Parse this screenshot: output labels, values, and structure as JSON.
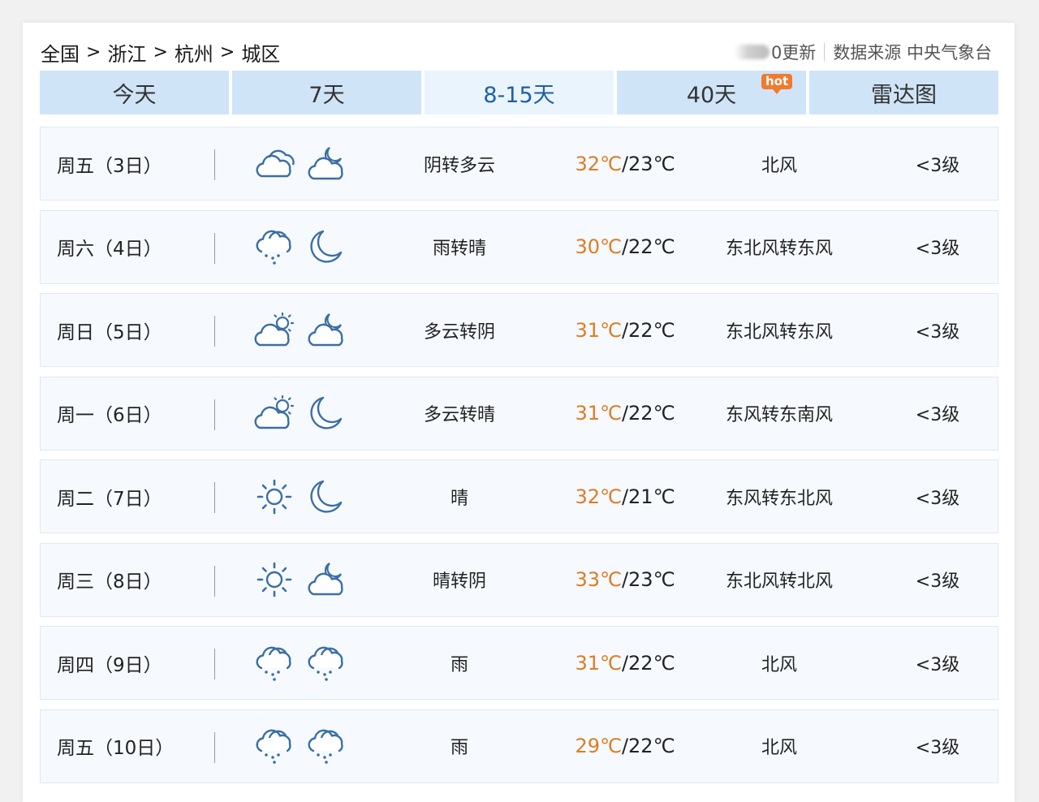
{
  "breadcrumb": {
    "items": [
      "全国",
      "浙江",
      "杭州",
      "城区"
    ],
    "separator": ">"
  },
  "meta": {
    "update_text": "0更新",
    "source_text": "数据来源 中央气象台"
  },
  "tabs": [
    {
      "label": "今天",
      "active": false
    },
    {
      "label": "7天",
      "active": false
    },
    {
      "label": "8-15天",
      "active": true
    },
    {
      "label": "40天",
      "active": false,
      "badge": "hot"
    },
    {
      "label": "雷达图",
      "active": false
    }
  ],
  "colors": {
    "tab_bg": "#cfe4f7",
    "tab_active_bg": "#eaf4fd",
    "tab_active_text": "#1f5fa6",
    "high_temp": "#e07b22",
    "icon_stroke": "#3a6fa5",
    "hot_badge": "#f07a2e"
  },
  "forecast": [
    {
      "day": "周五（3日）",
      "icon_day": "cloudy-icon",
      "icon_night": "partly-cloudy-night-icon",
      "weather": "阴转多云",
      "high": "32℃",
      "low": "/23℃",
      "wind": "北风",
      "level": "<3级"
    },
    {
      "day": "周六（4日）",
      "icon_day": "rain-icon",
      "icon_night": "moon-icon",
      "weather": "雨转晴",
      "high": "30℃",
      "low": "/22℃",
      "wind": "东北风转东风",
      "level": "<3级"
    },
    {
      "day": "周日（5日）",
      "icon_day": "partly-cloudy-day-icon",
      "icon_night": "partly-cloudy-night-icon",
      "weather": "多云转阴",
      "high": "31℃",
      "low": "/22℃",
      "wind": "东北风转东风",
      "level": "<3级"
    },
    {
      "day": "周一（6日）",
      "icon_day": "partly-cloudy-day-icon",
      "icon_night": "moon-icon",
      "weather": "多云转晴",
      "high": "31℃",
      "low": "/22℃",
      "wind": "东风转东南风",
      "level": "<3级"
    },
    {
      "day": "周二（7日）",
      "icon_day": "sun-icon",
      "icon_night": "moon-icon",
      "weather": "晴",
      "high": "32℃",
      "low": "/21℃",
      "wind": "东风转东北风",
      "level": "<3级"
    },
    {
      "day": "周三（8日）",
      "icon_day": "sun-icon",
      "icon_night": "partly-cloudy-night-icon",
      "weather": "晴转阴",
      "high": "33℃",
      "low": "/23℃",
      "wind": "东北风转北风",
      "level": "<3级"
    },
    {
      "day": "周四（9日）",
      "icon_day": "rain-icon",
      "icon_night": "rain-icon",
      "weather": "雨",
      "high": "31℃",
      "low": "/22℃",
      "wind": "北风",
      "level": "<3级"
    },
    {
      "day": "周五（10日）",
      "icon_day": "rain-icon",
      "icon_night": "rain-icon",
      "weather": "雨",
      "high": "29℃",
      "low": "/22℃",
      "wind": "北风",
      "level": "<3级"
    }
  ]
}
